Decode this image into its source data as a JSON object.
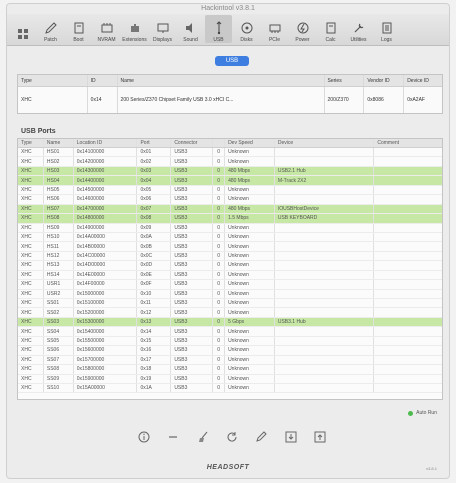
{
  "window": {
    "title": "Hackintool v3.8.1"
  },
  "toolbar": {
    "items": [
      {
        "label": "",
        "icon": "grid-icon"
      },
      {
        "label": "Patch",
        "icon": "pencil-icon"
      },
      {
        "label": "Boot",
        "icon": "boot-icon"
      },
      {
        "label": "NVRAM",
        "icon": "nvram-icon"
      },
      {
        "label": "Extensions",
        "icon": "extensions-icon"
      },
      {
        "label": "Displays",
        "icon": "display-icon"
      },
      {
        "label": "Sound",
        "icon": "speaker-icon"
      },
      {
        "label": "USB",
        "icon": "usb-icon",
        "active": true
      },
      {
        "label": "Disks",
        "icon": "disk-icon"
      },
      {
        "label": "PCIe",
        "icon": "pcie-icon"
      },
      {
        "label": "Power",
        "icon": "power-icon"
      },
      {
        "label": "Calc",
        "icon": "calc-icon"
      },
      {
        "label": "Utilities",
        "icon": "utilities-icon"
      },
      {
        "label": "Logs",
        "icon": "logs-icon"
      }
    ]
  },
  "segment": {
    "label": "USB"
  },
  "controllers": {
    "headers": [
      "Type",
      "ID",
      "Name",
      "Series",
      "Vendor ID",
      "Device ID"
    ],
    "rows": [
      [
        "XHC",
        "0x14",
        "200 Series/Z370 Chipset Family USB 3.0 xHCI C...",
        "200/Z370",
        "0x8086",
        "0xA2AF"
      ]
    ]
  },
  "ports_section": {
    "label": "USB Ports"
  },
  "ports": {
    "headers": [
      "Type",
      "Name",
      "Location ID",
      "Port",
      "Connector",
      "",
      "Dev Speed",
      "Device",
      "Comment"
    ],
    "rows": [
      [
        "XHC",
        "HS01",
        "0x14100000",
        "0x01",
        "USB3",
        "0",
        "Unknown",
        "",
        ""
      ],
      [
        "XHC",
        "HS02",
        "0x14200000",
        "0x02",
        "USB3",
        "0",
        "Unknown",
        "",
        ""
      ],
      [
        "XHC",
        "HS03",
        "0x14300000",
        "0x03",
        "USB3",
        "0",
        "480 Mbps",
        "USB2.1 Hub",
        ""
      ],
      [
        "XHC",
        "HS04",
        "0x14400000",
        "0x04",
        "USB3",
        "0",
        "480 Mbps",
        "M-Track 2X2",
        ""
      ],
      [
        "XHC",
        "HS05",
        "0x14500000",
        "0x05",
        "USB3",
        "0",
        "Unknown",
        "",
        ""
      ],
      [
        "XHC",
        "HS06",
        "0x14600000",
        "0x06",
        "USB3",
        "0",
        "Unknown",
        "",
        ""
      ],
      [
        "XHC",
        "HS07",
        "0x14700000",
        "0x07",
        "USB3",
        "0",
        "480 Mbps",
        "IOUSBHostDevice",
        ""
      ],
      [
        "XHC",
        "HS08",
        "0x14800000",
        "0x08",
        "USB3",
        "0",
        "1.5 Mbps",
        "USB KEYBOARD",
        ""
      ],
      [
        "XHC",
        "HS09",
        "0x14900000",
        "0x09",
        "USB3",
        "0",
        "Unknown",
        "",
        ""
      ],
      [
        "XHC",
        "HS10",
        "0x14A00000",
        "0x0A",
        "USB3",
        "0",
        "Unknown",
        "",
        ""
      ],
      [
        "XHC",
        "HS11",
        "0x14B00000",
        "0x0B",
        "USB3",
        "0",
        "Unknown",
        "",
        ""
      ],
      [
        "XHC",
        "HS12",
        "0x14C00000",
        "0x0C",
        "USB3",
        "0",
        "Unknown",
        "",
        ""
      ],
      [
        "XHC",
        "HS13",
        "0x14D00000",
        "0x0D",
        "USB3",
        "0",
        "Unknown",
        "",
        ""
      ],
      [
        "XHC",
        "HS14",
        "0x14E00000",
        "0x0E",
        "USB3",
        "0",
        "Unknown",
        "",
        ""
      ],
      [
        "XHC",
        "USR1",
        "0x14F00000",
        "0x0F",
        "USB3",
        "0",
        "Unknown",
        "",
        ""
      ],
      [
        "XHC",
        "USR2",
        "0x15000000",
        "0x10",
        "USB3",
        "0",
        "Unknown",
        "",
        ""
      ],
      [
        "XHC",
        "SS01",
        "0x15100000",
        "0x11",
        "USB3",
        "0",
        "Unknown",
        "",
        ""
      ],
      [
        "XHC",
        "SS02",
        "0x15200000",
        "0x12",
        "USB3",
        "0",
        "Unknown",
        "",
        ""
      ],
      [
        "XHC",
        "SS03",
        "0x15300000",
        "0x13",
        "USB3",
        "0",
        "5 Gbps",
        "USB3.1 Hub",
        ""
      ],
      [
        "XHC",
        "SS04",
        "0x15400000",
        "0x14",
        "USB3",
        "0",
        "Unknown",
        "",
        ""
      ],
      [
        "XHC",
        "SS05",
        "0x15500000",
        "0x15",
        "USB3",
        "0",
        "Unknown",
        "",
        ""
      ],
      [
        "XHC",
        "SS06",
        "0x15600000",
        "0x16",
        "USB3",
        "0",
        "Unknown",
        "",
        ""
      ],
      [
        "XHC",
        "SS07",
        "0x15700000",
        "0x17",
        "USB3",
        "0",
        "Unknown",
        "",
        ""
      ],
      [
        "XHC",
        "SS08",
        "0x15800000",
        "0x18",
        "USB3",
        "0",
        "Unknown",
        "",
        ""
      ],
      [
        "XHC",
        "SS09",
        "0x15900000",
        "0x19",
        "USB3",
        "0",
        "Unknown",
        "",
        ""
      ],
      [
        "XHC",
        "SS10",
        "0x15A00000",
        "0x1A",
        "USB3",
        "0",
        "Unknown",
        "",
        ""
      ]
    ],
    "highlighted": [
      2,
      3,
      6,
      7,
      18
    ],
    "highlight_color": "#c6e8a4"
  },
  "status": {
    "auto_run_label": "Auto Run",
    "indicator_color": "#4dbb4d"
  },
  "bottom_tools": [
    {
      "icon": "info-icon"
    },
    {
      "icon": "minus-icon"
    },
    {
      "icon": "broom-icon"
    },
    {
      "icon": "refresh-icon"
    },
    {
      "icon": "pen-icon"
    },
    {
      "icon": "import-icon"
    },
    {
      "icon": "export-icon"
    }
  ],
  "footer": {
    "brand": "HEADSOFT",
    "version": "v3.8.1"
  },
  "accent_color": "#3d7ee0"
}
